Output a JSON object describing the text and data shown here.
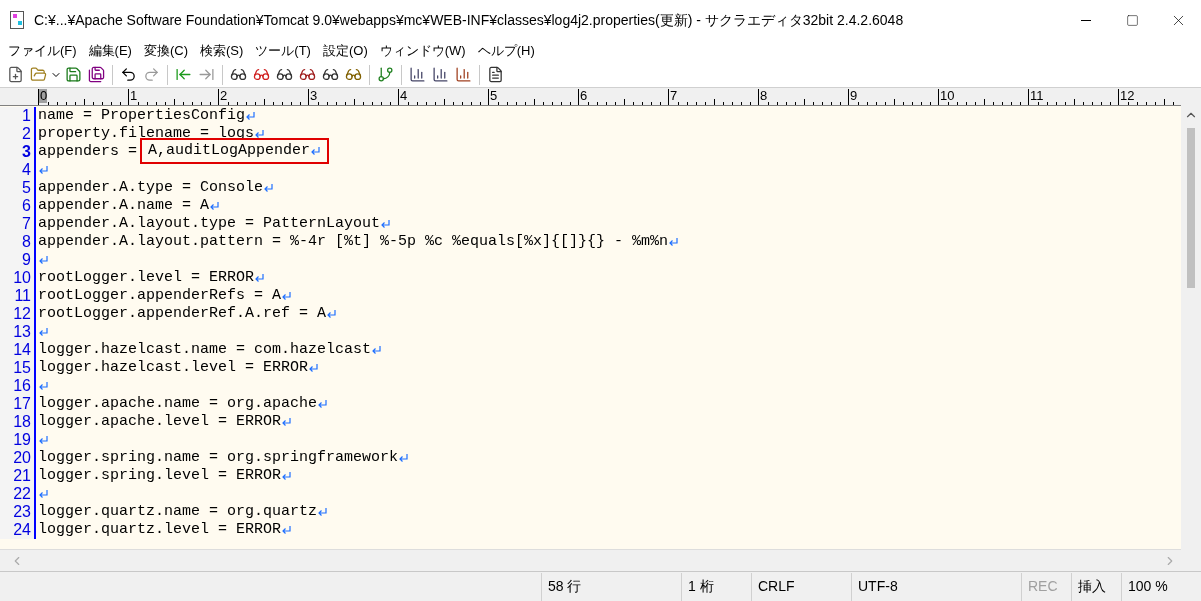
{
  "window": {
    "title": "C:¥...¥Apache Software Foundation¥Tomcat 9.0¥webapps¥mc¥WEB-INF¥classes¥log4j2.properties(更新) - サクラエディタ32bit 2.4.2.6048"
  },
  "menu": [
    "ファイル(F)",
    "編集(E)",
    "変換(C)",
    "検索(S)",
    "ツール(T)",
    "設定(O)",
    "ウィンドウ(W)",
    "ヘルプ(H)"
  ],
  "ruler": [
    "0",
    "1",
    "2",
    "3",
    "4",
    "5",
    "6",
    "7",
    "8",
    "9",
    "10",
    "11",
    "12"
  ],
  "lines": [
    {
      "number": "1",
      "text": "name = PropertiesConfig",
      "current": false
    },
    {
      "number": "2",
      "text": "property.filename = logs",
      "current": false
    },
    {
      "number": "3",
      "text": "appenders = ",
      "marked": "A,auditLogAppender",
      "current": true
    },
    {
      "number": "4",
      "current": false
    },
    {
      "number": "5",
      "text": "appender.A.type = Console",
      "current": false
    },
    {
      "number": "6",
      "text": "appender.A.name = A",
      "current": false
    },
    {
      "number": "7",
      "text": "appender.A.layout.type = PatternLayout",
      "current": false
    },
    {
      "number": "8",
      "text": "appender.A.layout.pattern = %-4r [%t] %-5p %c %equals[%x]{[]}{} - %m%n",
      "current": false
    },
    {
      "number": "9",
      "current": false
    },
    {
      "number": "10",
      "text": "rootLogger.level = ERROR",
      "current": false
    },
    {
      "number": "11",
      "text": "rootLogger.appenderRefs = A",
      "current": false
    },
    {
      "number": "12",
      "text": "rootLogger.appenderRef.A.ref = A",
      "current": false
    },
    {
      "number": "13",
      "current": false
    },
    {
      "number": "14",
      "text": "logger.hazelcast.name = com.hazelcast",
      "current": false
    },
    {
      "number": "15",
      "text": "logger.hazelcast.level = ERROR",
      "current": false
    },
    {
      "number": "16",
      "current": false
    },
    {
      "number": "17",
      "text": "logger.apache.name = org.apache",
      "current": false
    },
    {
      "number": "18",
      "text": "logger.apache.level = ERROR",
      "current": false
    },
    {
      "number": "19",
      "current": false
    },
    {
      "number": "20",
      "text": "logger.spring.name = org.springframework",
      "current": false
    },
    {
      "number": "21",
      "text": "logger.spring.level = ERROR",
      "current": false
    },
    {
      "number": "22",
      "current": false
    },
    {
      "number": "23",
      "text": "logger.quartz.name = org.quartz",
      "current": false
    },
    {
      "number": "24",
      "text": "logger.quartz.level = ERROR",
      "current": false
    }
  ],
  "status_bar": [
    {
      "text": "58 行",
      "disabled": false
    },
    {
      "text": "1 桁",
      "disabled": false
    },
    {
      "text": "CRLF",
      "disabled": false
    },
    {
      "text": "UTF-8",
      "disabled": false
    },
    {
      "text": "REC",
      "disabled": true
    },
    {
      "text": "挿入",
      "disabled": false
    },
    {
      "text": "100 %",
      "disabled": false
    }
  ]
}
